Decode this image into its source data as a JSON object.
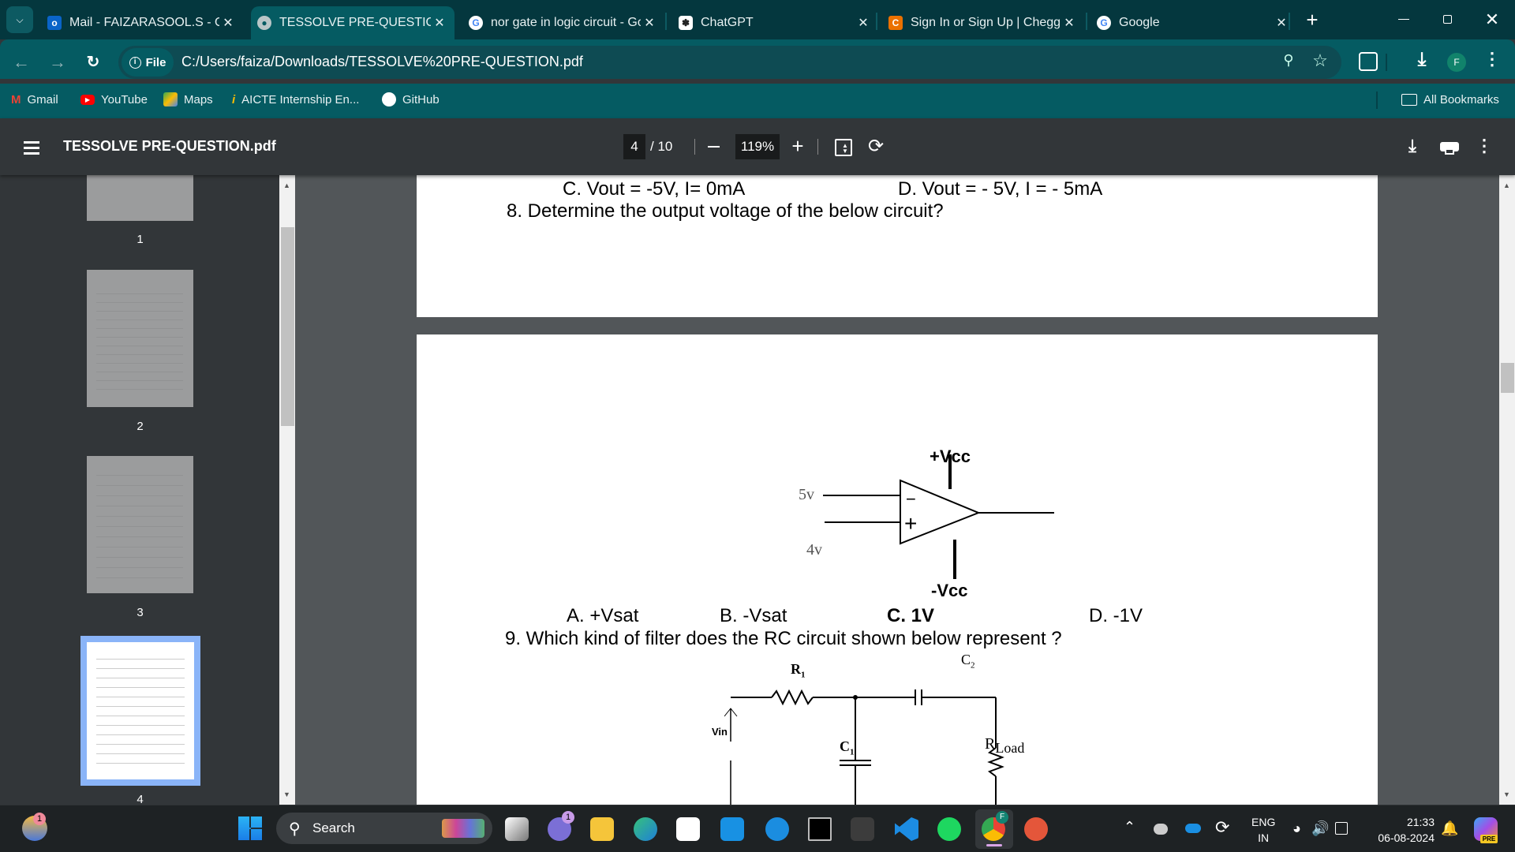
{
  "browser": {
    "tabs": [
      {
        "title": "Mail - FAIZARASOOL.S - Outlook",
        "icon": "outlook-icon",
        "active": false
      },
      {
        "title": "TESSOLVE PRE-QUESTION.pdf",
        "icon": "globe-icon",
        "active": true
      },
      {
        "title": "nor gate in logic circuit - Google Search",
        "icon": "google-icon",
        "active": false
      },
      {
        "title": "ChatGPT",
        "icon": "chatgpt-icon",
        "active": false
      },
      {
        "title": "Sign In or Sign Up | Chegg.com",
        "icon": "chegg-icon",
        "active": false
      },
      {
        "title": "Google",
        "icon": "google-icon",
        "active": false
      }
    ],
    "close_glyph": "✕",
    "new_tab_glyph": "+",
    "address": {
      "chip": "File",
      "url": "C:/Users/faiza/Downloads/TESSOLVE%20PRE-QUESTION.pdf"
    },
    "profile_initial": "F",
    "bookmarks": [
      {
        "label": "Gmail",
        "icon": "gmail-icon"
      },
      {
        "label": "YouTube",
        "icon": "youtube-icon"
      },
      {
        "label": "Maps",
        "icon": "maps-icon"
      },
      {
        "label": "AICTE Internship En...",
        "icon": "aicte-icon"
      },
      {
        "label": "GitHub",
        "icon": "github-icon"
      }
    ],
    "all_bookmarks": "All Bookmarks"
  },
  "pdf": {
    "filename": "TESSOLVE PRE-QUESTION.pdf",
    "current_page": "4",
    "total_pages": "/ 10",
    "zoom": "119%",
    "thumbnails": [
      {
        "number": "1"
      },
      {
        "number": "2"
      },
      {
        "number": "3"
      },
      {
        "number": "4",
        "selected": true
      }
    ],
    "page3_tail": {
      "option_c": "C.  Vout = -5V, I= 0mA",
      "option_d": "D. Vout = - 5V, I = - 5mA",
      "question8": "8. Determine the output voltage of the below circuit?"
    },
    "page4": {
      "opamp": {
        "plus_vcc": "+Vcc",
        "minus_vcc": "-Vcc",
        "in_top": "5v",
        "in_bottom": "4v",
        "minus_sign": "−",
        "plus_sign": "+"
      },
      "q8_options": {
        "a": "A. +Vsat",
        "b": "B. -Vsat",
        "c": "C. 1V",
        "d": "D. -1V"
      },
      "question9": "9. Which kind of filter does the RC circuit shown below represent ?",
      "rc": {
        "r1": "R",
        "r1_sub": "1",
        "c2": "C",
        "c2_sub": "2",
        "c1": "C",
        "c1_sub": "1",
        "vin": "Vin",
        "rload": "R",
        "rload_sub": "Load"
      }
    }
  },
  "taskbar": {
    "search_placeholder": "Search",
    "weather_badge": "1",
    "chat_badge": "1",
    "language": "ENG",
    "region": "IN",
    "time": "21:33",
    "date": "06-08-2024",
    "copilot_badge": "PRE",
    "chrome_profile": "F"
  },
  "colors": {
    "tab_strip": "#04373e",
    "toolbar": "#055b62",
    "pdf_bar": "#323639",
    "viewer_bg": "#525659",
    "thumb_selected": "#8ab4f8"
  }
}
